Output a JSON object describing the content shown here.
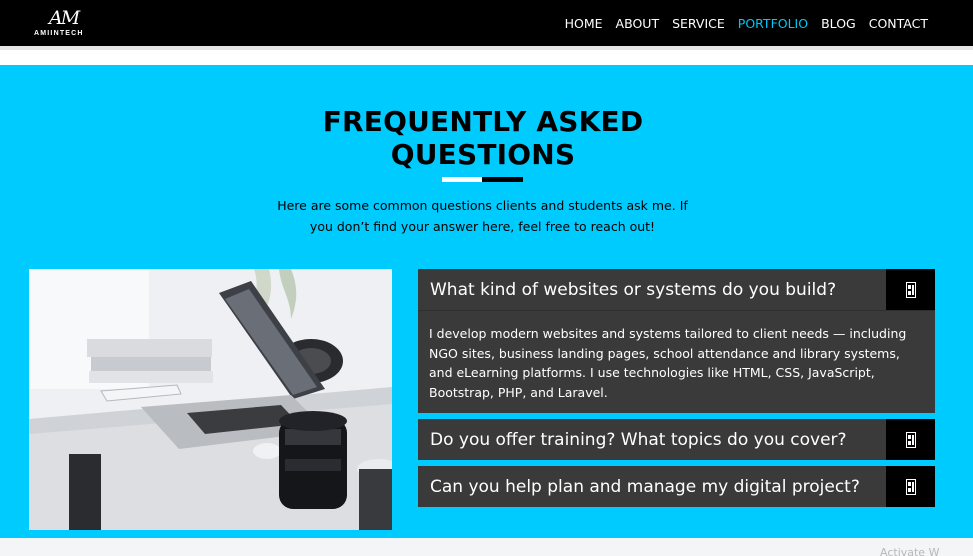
{
  "brand": {
    "mark": "AM",
    "name": "AMIINTECH"
  },
  "nav": {
    "items": [
      {
        "label": "HOME",
        "active": false
      },
      {
        "label": "ABOUT",
        "active": false
      },
      {
        "label": "SERVICE",
        "active": false
      },
      {
        "label": "PORTFOLIO",
        "active": true
      },
      {
        "label": "BLOG",
        "active": false
      },
      {
        "label": "CONTACT",
        "active": false
      }
    ],
    "active_color": "#00c8f5"
  },
  "faq": {
    "title_line1": "FREQUENTLY ASKED",
    "title_line2": "QUESTIONS",
    "intro": "Here are some common questions clients and students ask me. If you don’t find your answer here, feel free to reach out!",
    "items": [
      {
        "question": "What kind of websites or systems do you build?",
        "expanded": true,
        "answer": "I develop modern websites and systems tailored to client needs — including NGO sites, business landing pages, school attendance and library systems, and eLearning platforms. I use technologies like HTML, CSS, JavaScript, Bootstrap, PHP, and Laravel."
      },
      {
        "question": "Do you offer training? What topics do you cover?",
        "expanded": false
      },
      {
        "question": "Can you help plan and manage my digital project?",
        "expanded": false
      }
    ]
  },
  "colors": {
    "section_bg": "#00cbff",
    "accordion_bg": "#3a3a3a",
    "toggle_bg": "#000000"
  },
  "watermark": "Activate W"
}
